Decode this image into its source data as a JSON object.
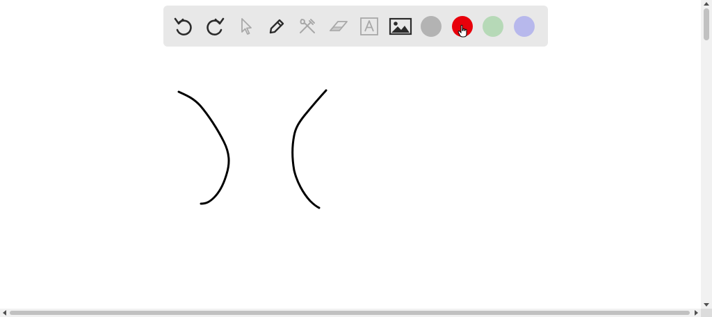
{
  "toolbar": {
    "tools": [
      {
        "icon": "undo-icon",
        "enabled": true
      },
      {
        "icon": "redo-icon",
        "enabled": true
      },
      {
        "icon": "pointer-icon",
        "enabled": false
      },
      {
        "icon": "pencil-icon",
        "enabled": true
      },
      {
        "icon": "tools-icon",
        "enabled": false
      },
      {
        "icon": "eraser-icon",
        "enabled": false
      },
      {
        "icon": "text-icon",
        "enabled": false
      },
      {
        "icon": "image-icon",
        "enabled": true
      }
    ],
    "colors": [
      {
        "name": "gray",
        "hex": "#b3b3b3"
      },
      {
        "name": "red",
        "hex": "#e8000b",
        "selected": true
      },
      {
        "name": "green",
        "hex": "#b6d9b7"
      },
      {
        "name": "blue",
        "hex": "#b7b8ec"
      }
    ]
  },
  "canvas": {
    "stroke_color": "#000000",
    "strokes": 2
  }
}
